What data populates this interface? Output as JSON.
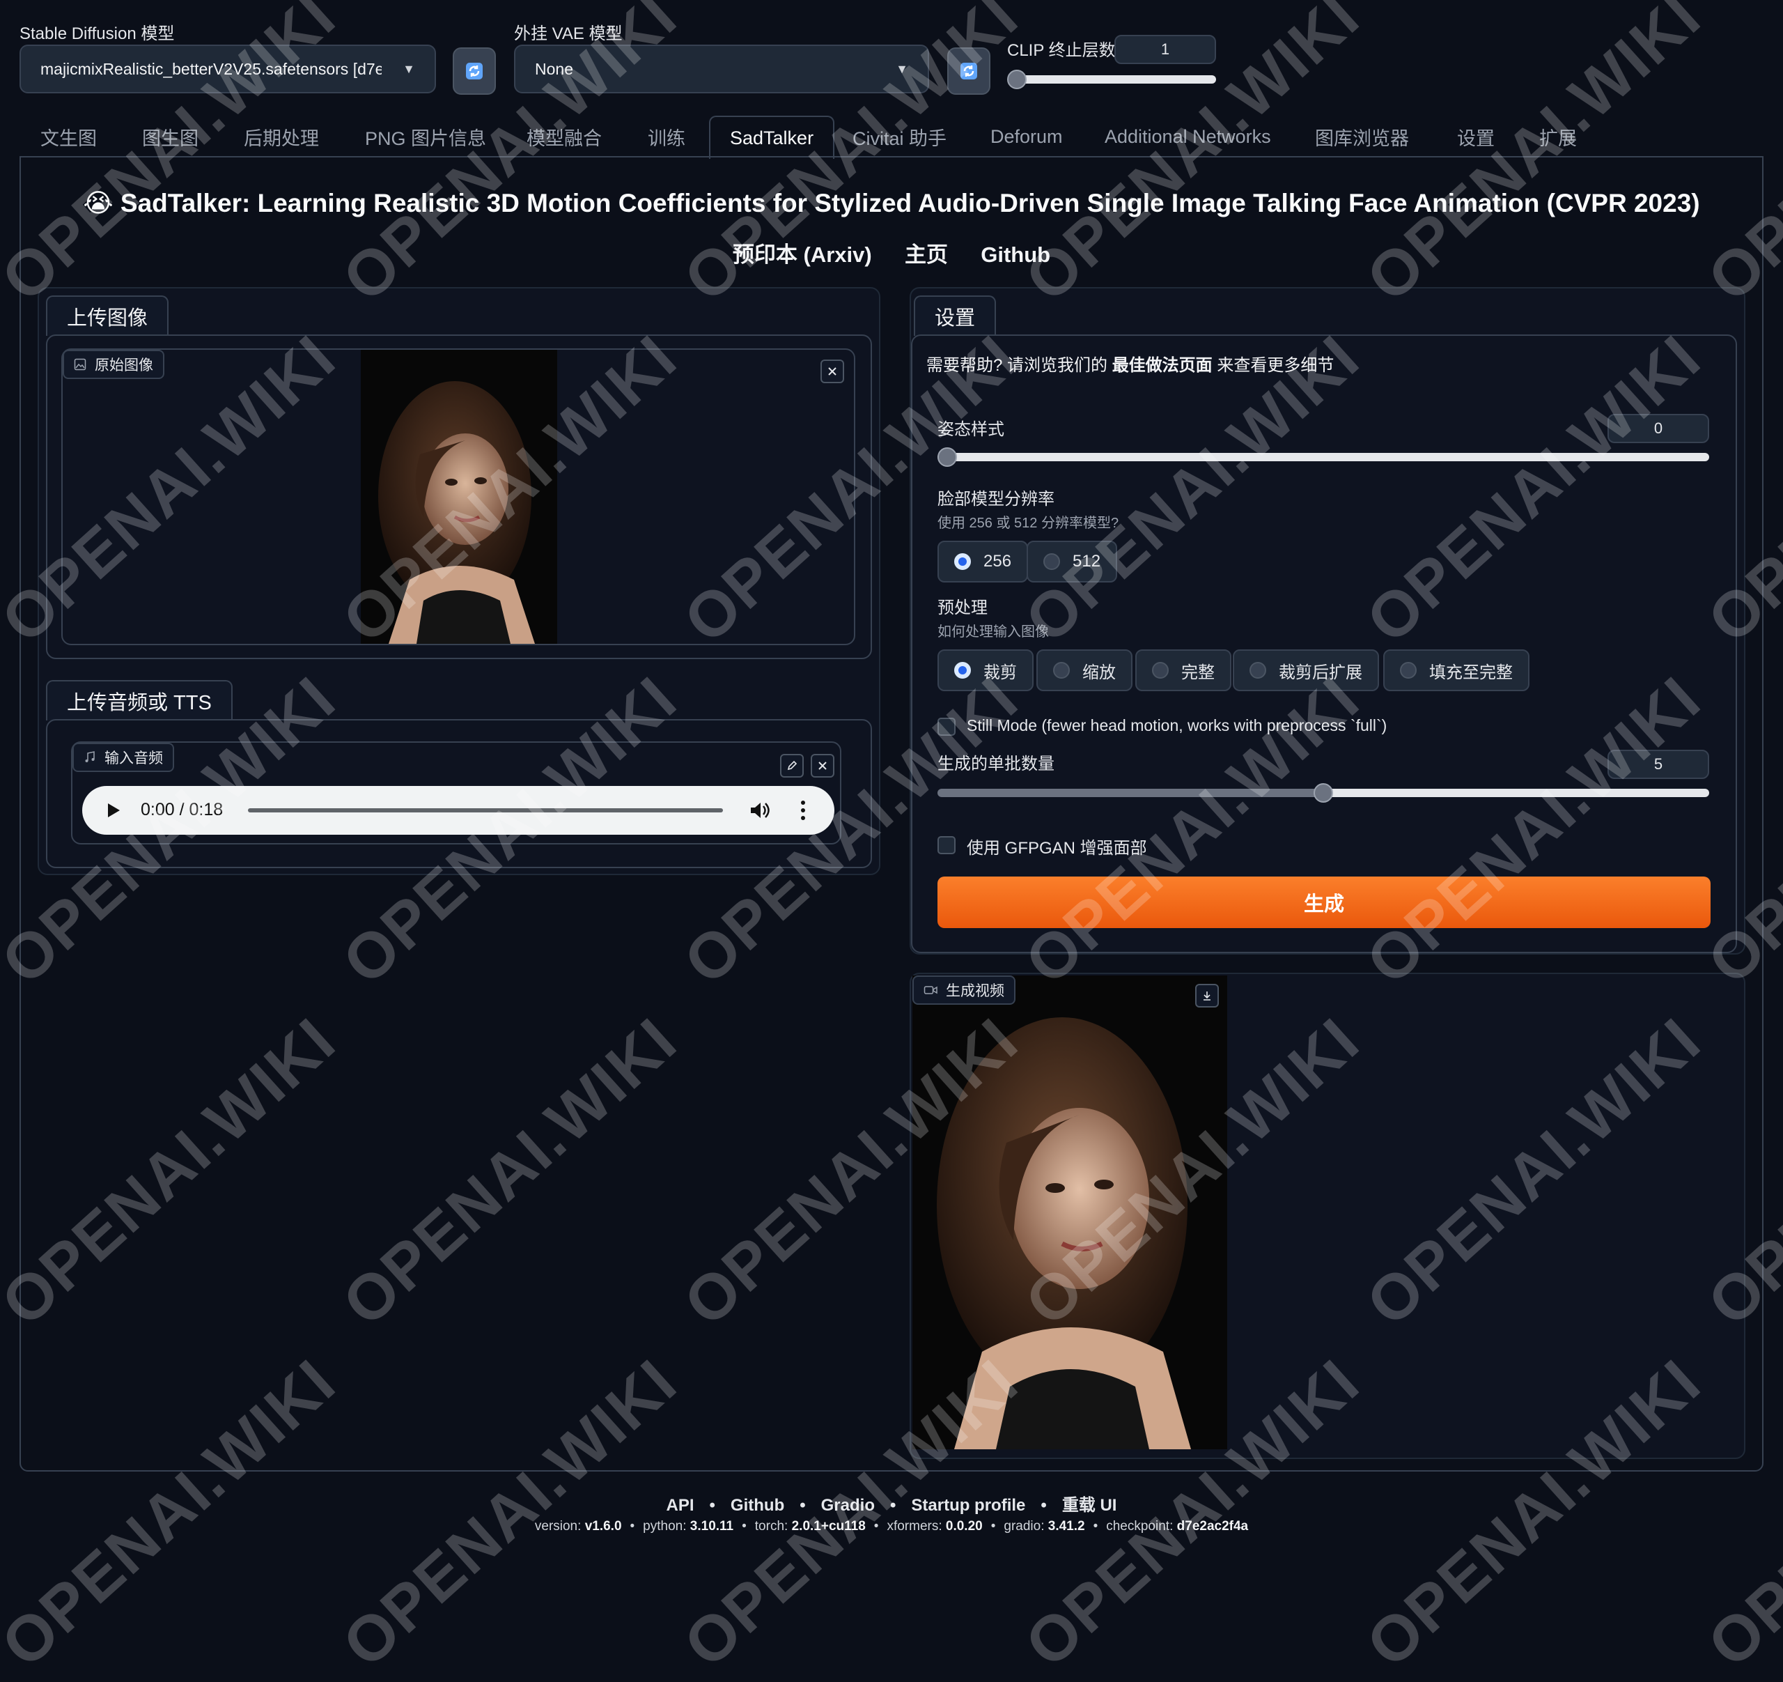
{
  "top": {
    "sd_model_label": "Stable Diffusion 模型",
    "sd_model_value": "majicmixRealistic_betterV2V25.safetensors [d7e",
    "vae_label": "外挂 VAE 模型",
    "vae_value": "None",
    "clip_label": "CLIP 终止层数",
    "clip_value": "1",
    "clip_fraction": 0
  },
  "tabs": [
    {
      "label": "文生图"
    },
    {
      "label": "图生图"
    },
    {
      "label": "后期处理"
    },
    {
      "label": "PNG 图片信息"
    },
    {
      "label": "模型融合"
    },
    {
      "label": "训练"
    },
    {
      "label": "SadTalker",
      "active": true
    },
    {
      "label": "Civitai 助手"
    },
    {
      "label": "Deforum"
    },
    {
      "label": "Additional Networks"
    },
    {
      "label": "图库浏览器"
    },
    {
      "label": "设置"
    },
    {
      "label": "扩展"
    }
  ],
  "header": {
    "emoji": "😭",
    "title": "SadTalker: Learning Realistic 3D Motion Coefficients for Stylized Audio-Driven Single Image Talking Face Animation (CVPR 2023)",
    "links": [
      "预印本 (Arxiv)",
      "主页",
      "Github"
    ]
  },
  "left": {
    "upload_image_tab": "上传图像",
    "original_image_label": "原始图像",
    "upload_audio_tab": "上传音频或 TTS",
    "input_audio_label": "输入音频",
    "audio_time": "0:00 / 0:18"
  },
  "settings": {
    "tab": "设置",
    "help_prefix": "需要帮助? 请浏览我们的 ",
    "help_link": "最佳做法页面",
    "help_suffix": " 来查看更多细节",
    "pose_label": "姿态样式",
    "pose_value": "0",
    "pose_fraction": 0,
    "res_label": "脸部模型分辨率",
    "res_info": "使用 256 或 512 分辨率模型?",
    "res_options": [
      "256",
      "512"
    ],
    "res_selected": "256",
    "pre_label": "预处理",
    "pre_info": "如何处理输入图像",
    "pre_options": [
      "裁剪",
      "缩放",
      "完整",
      "裁剪后扩展",
      "填充至完整"
    ],
    "pre_selected": "裁剪",
    "still_mode_label": "Still Mode (fewer head motion, works with preprocess `full`)",
    "batch_label": "生成的单批数量",
    "batch_value": "5",
    "batch_fraction": 0.5,
    "gfpgan_label": "使用 GFPGAN 增强面部",
    "generate_label": "生成"
  },
  "output": {
    "video_label": "生成视频"
  },
  "footer": {
    "links": [
      "API",
      "Github",
      "Gradio",
      "Startup profile",
      "重载 UI"
    ],
    "version_items": [
      {
        "k": "version: ",
        "v": "v1.6.0"
      },
      {
        "k": "python: ",
        "v": "3.10.11"
      },
      {
        "k": "torch: ",
        "v": "2.0.1+cu118"
      },
      {
        "k": "xformers: ",
        "v": "0.0.20"
      },
      {
        "k": "gradio: ",
        "v": "3.41.2"
      },
      {
        "k": "checkpoint: ",
        "v": "d7e2ac2f4a"
      }
    ]
  },
  "watermark": "OPENAI.WIKI",
  "colors": {
    "background": "#0b0f19",
    "accent_orange": "#f97316",
    "radio_blue": "#2563eb"
  }
}
